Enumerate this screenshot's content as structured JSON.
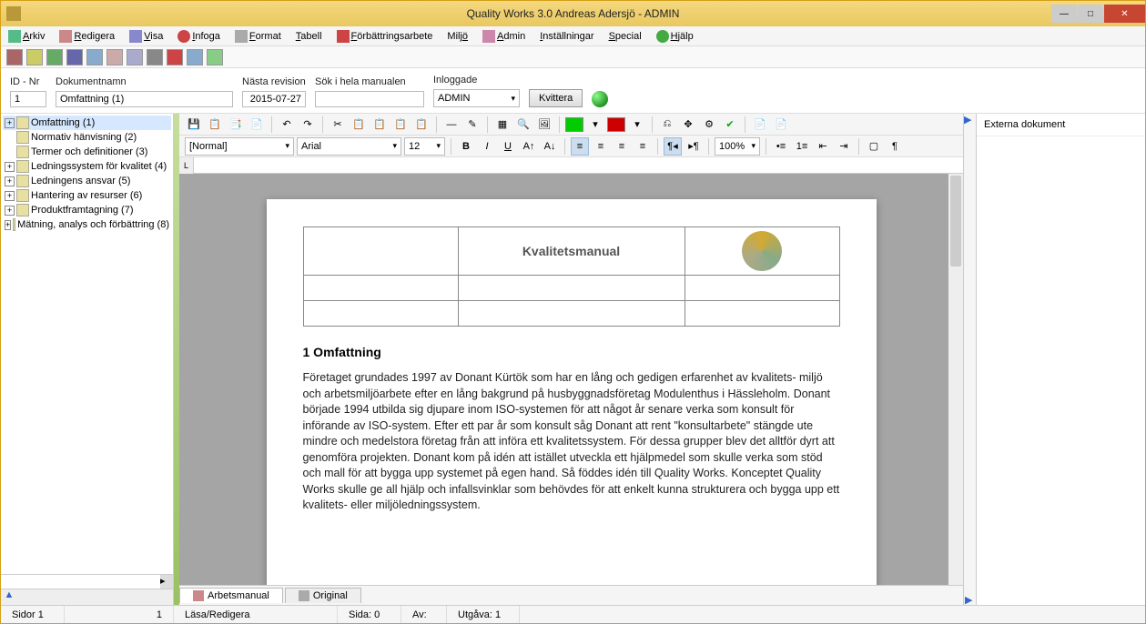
{
  "window": {
    "title": "Quality Works 3.0 Andreas Adersjö - ADMIN"
  },
  "menu": {
    "items": [
      {
        "label": "Arkiv",
        "key": "A"
      },
      {
        "label": "Redigera",
        "key": "R"
      },
      {
        "label": "Visa",
        "key": "V"
      },
      {
        "label": "Infoga",
        "key": "I"
      },
      {
        "label": "Format",
        "key": "F"
      },
      {
        "label": "Tabell",
        "key": "T"
      },
      {
        "label": "Förbättringsarbete",
        "key": "F"
      },
      {
        "label": "Miljö",
        "key": "M"
      },
      {
        "label": "Admin",
        "key": "A"
      },
      {
        "label": "Inställningar",
        "key": "I"
      },
      {
        "label": "Special",
        "key": "S"
      },
      {
        "label": "Hjälp",
        "key": "H"
      }
    ]
  },
  "form": {
    "label_idnr": "ID - Nr",
    "val_idnr": "1",
    "label_doknamn": "Dokumentnamn",
    "val_doknamn": "Omfattning (1)",
    "label_revision": "Nästa revision",
    "val_revision": "2015-07-27",
    "label_search": "Sök i hela manualen",
    "val_search": "",
    "label_inloggad": "Inloggade",
    "val_inloggad": "ADMIN",
    "btn_kvittera": "Kvittera"
  },
  "tree": {
    "items": [
      {
        "label": "Omfattning (1)",
        "sel": true,
        "expand": true
      },
      {
        "label": "Normativ hänvisning (2)",
        "sel": false,
        "expand": false
      },
      {
        "label": "Termer och definitioner (3)",
        "sel": false,
        "expand": false
      },
      {
        "label": "Ledningssystem för kvalitet (4)",
        "sel": false,
        "expand": true
      },
      {
        "label": "Ledningens ansvar (5)",
        "sel": false,
        "expand": true
      },
      {
        "label": "Hantering av resurser (6)",
        "sel": false,
        "expand": true
      },
      {
        "label": "Produktframtagning (7)",
        "sel": false,
        "expand": true
      },
      {
        "label": "Mätning, analys och förbättring (8)",
        "sel": false,
        "expand": true
      }
    ]
  },
  "editor": {
    "style": "[Normal]",
    "font": "Arial",
    "size": "12",
    "zoom": "100%"
  },
  "document": {
    "header_title": "Kvalitetsmanual",
    "section_title": "1 Omfattning",
    "body": "Företaget grundades 1997 av Donant Kürtök som har en lång och gedigen erfarenhet av kvalitets- miljö och arbetsmiljöarbete efter en lång bakgrund på husbyggnadsföretag Modulenthus i Hässleholm. Donant började 1994 utbilda sig djupare inom ISO-systemen för att något år senare verka som konsult för införande av ISO-system.\nEfter ett par år som konsult såg Donant att rent \"konsultarbete\" stängde ute mindre och medelstora företag från att införa ett kvalitetssystem. För dessa grupper blev det alltför dyrt att genomföra projekten. Donant kom på idén att istället utveckla ett hjälpmedel som skulle verka som stöd och mall för att bygga upp systemet på egen hand. Så föddes idén till Quality Works. Konceptet Quality Works skulle ge all hjälp och infallsvinklar som behövdes för att enkelt kunna strukturera och bygga upp ett kvalitets- eller miljöledningssystem."
  },
  "tabs": {
    "arbetsmanual": "Arbetsmanual",
    "original": "Original"
  },
  "rightpanel": {
    "header": "Externa dokument"
  },
  "status": {
    "sidor": "Sidor 1",
    "page": "1",
    "mode": "Läsa/Redigera",
    "sida": "Sida: 0",
    "av": "Av:",
    "utgava": "Utgåva: 1"
  }
}
